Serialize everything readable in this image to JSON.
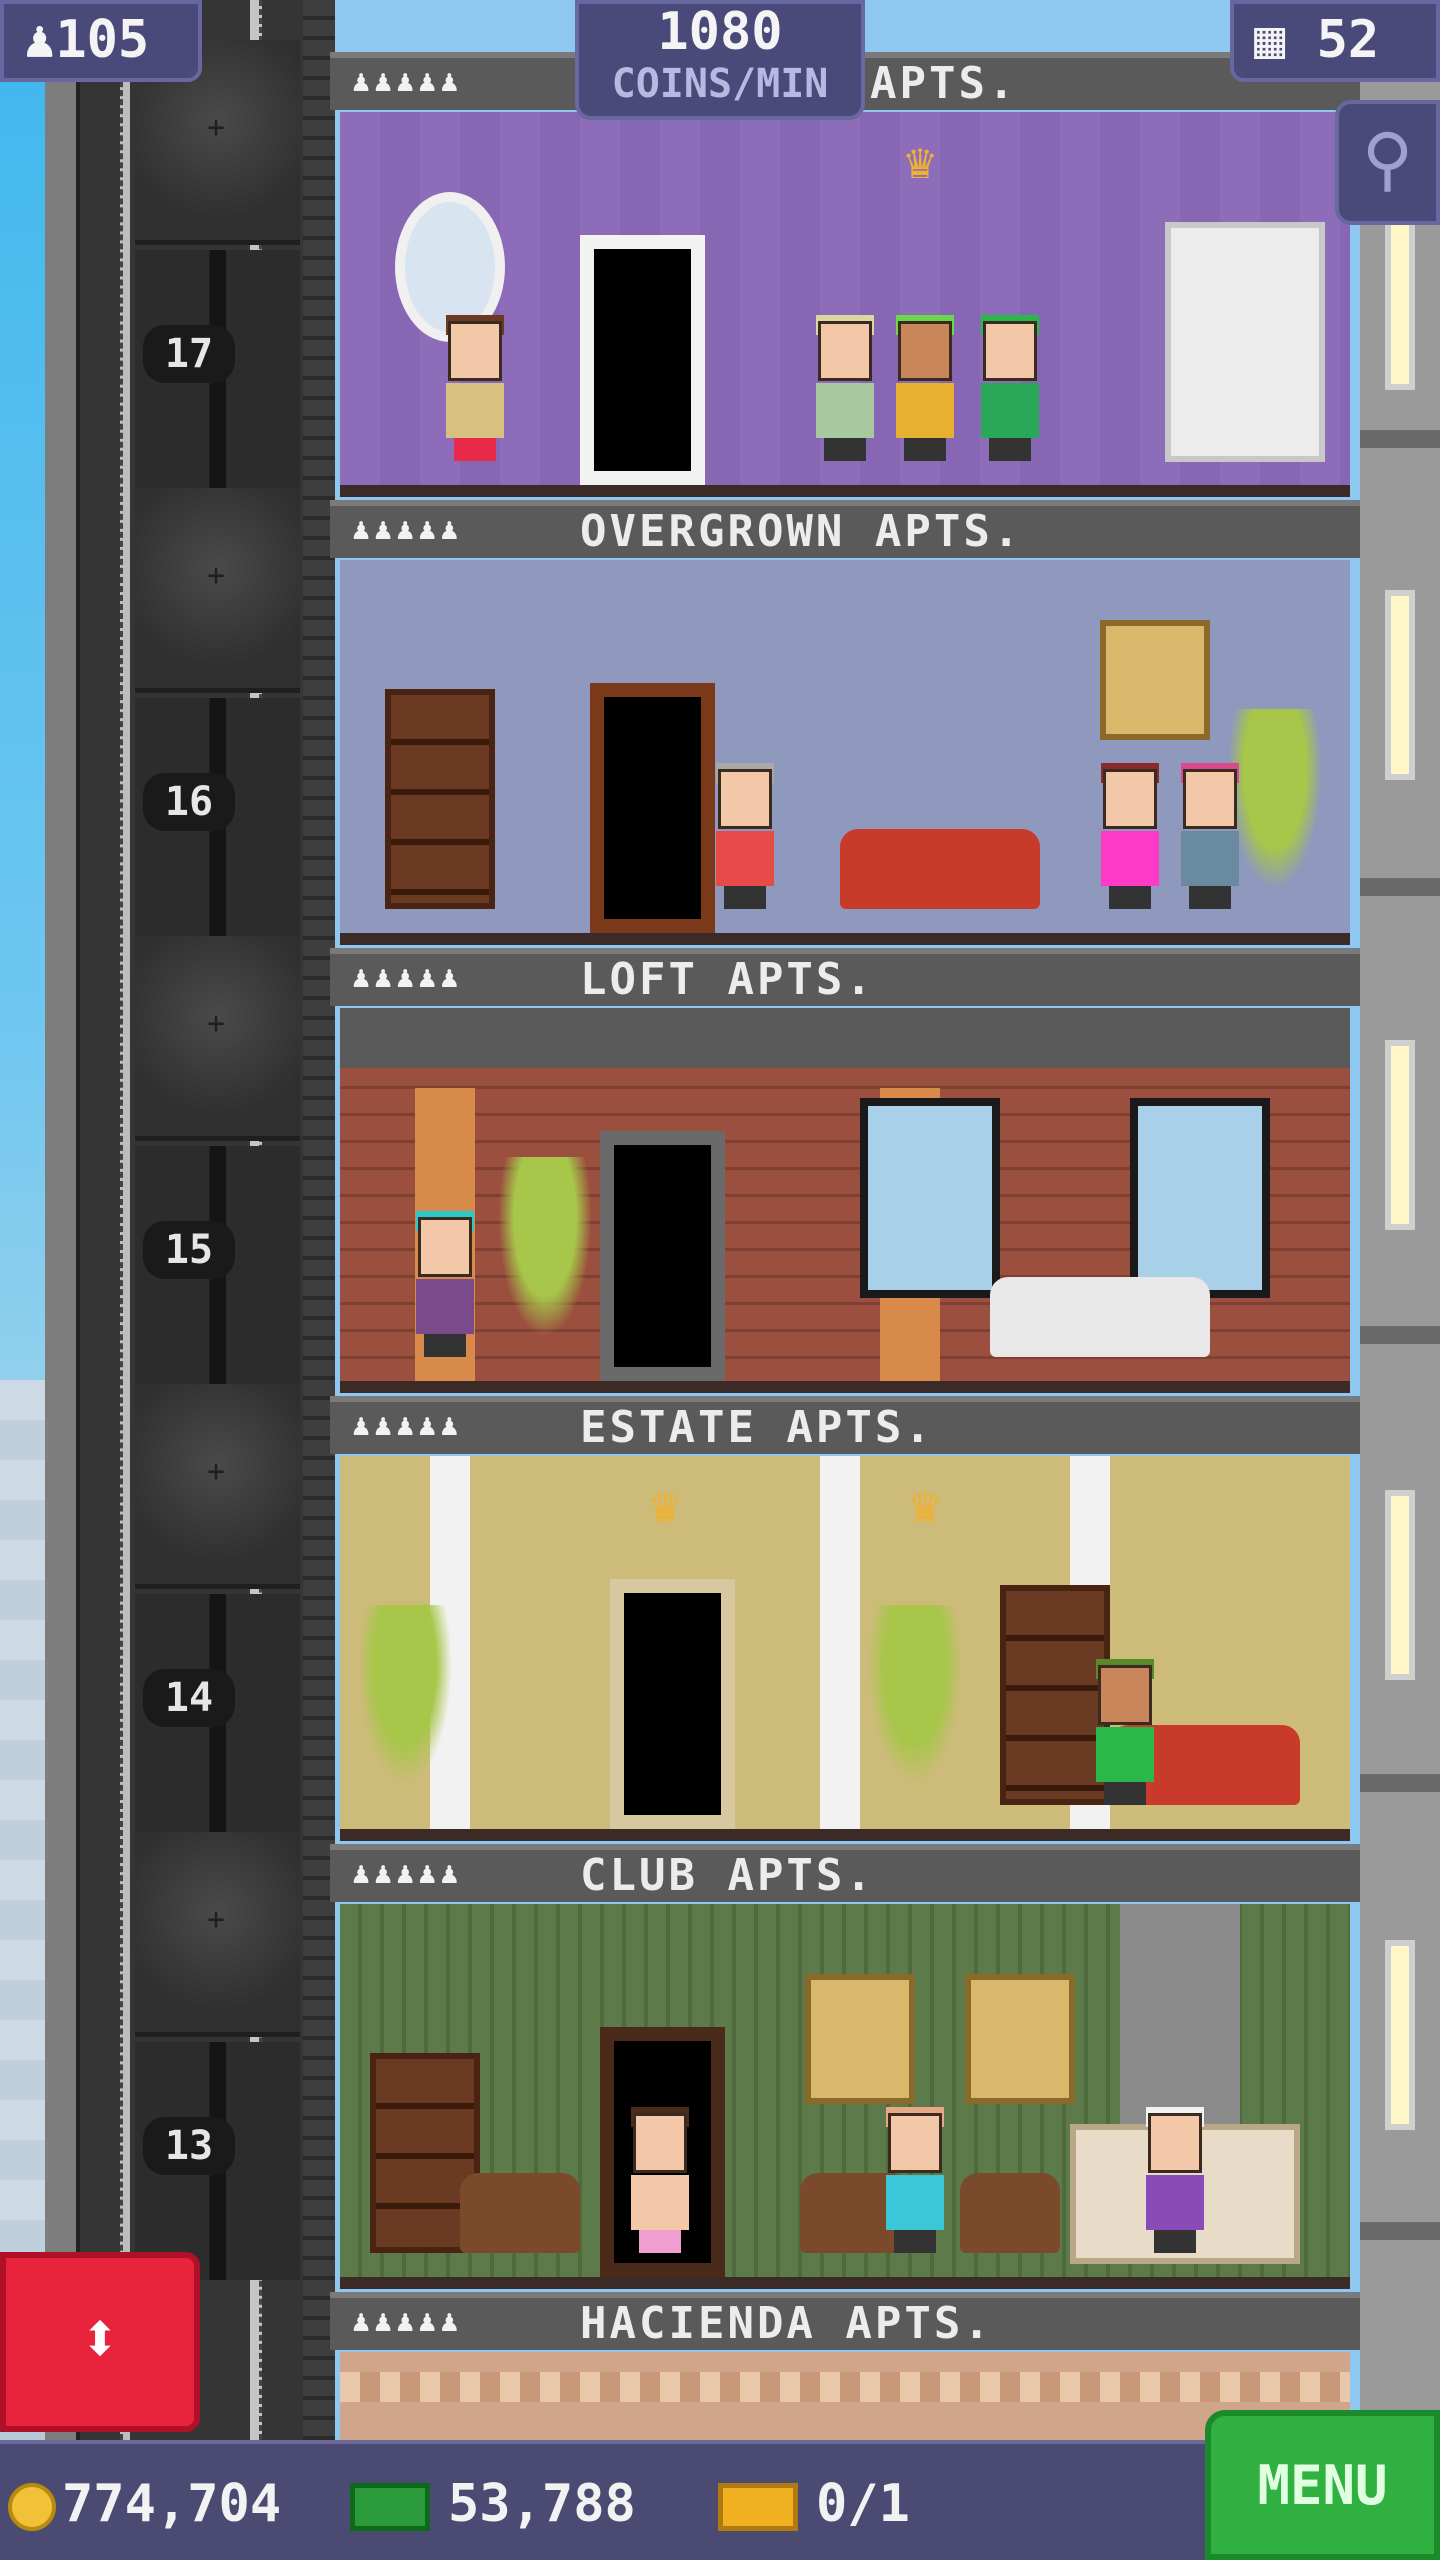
{
  "hud": {
    "population": "105",
    "coins_per_min_value": "1080",
    "coins_per_min_unit": "COINS/MIN",
    "floor_count": "52"
  },
  "floors": [
    {
      "label": "APTS.",
      "number": "17"
    },
    {
      "label": "OVERGROWN APTS.",
      "number": "16"
    },
    {
      "label": "LOFT APTS.",
      "number": "15"
    },
    {
      "label": "ESTATE APTS.",
      "number": "14"
    },
    {
      "label": "CLUB APTS.",
      "number": "13"
    },
    {
      "label": "HACIENDA APTS."
    }
  ],
  "resident_dots": "♟♟♟♟♟",
  "bottom_bar": {
    "coins": "774,704",
    "bux": "53,788",
    "tickets": "0/1",
    "menu_label": "MENU"
  },
  "icons": {
    "population": "person-icon",
    "floors": "building-icon",
    "zoom": "magnifier-icon",
    "elevator": "up-down-arrows-icon",
    "coins": "coin-icon",
    "bux": "bux-icon",
    "tickets": "ticket-icon"
  },
  "colors": {
    "hud_bg": "#4a4a7a",
    "elevator_button": "#e8243c",
    "menu_button": "#2fb040"
  }
}
